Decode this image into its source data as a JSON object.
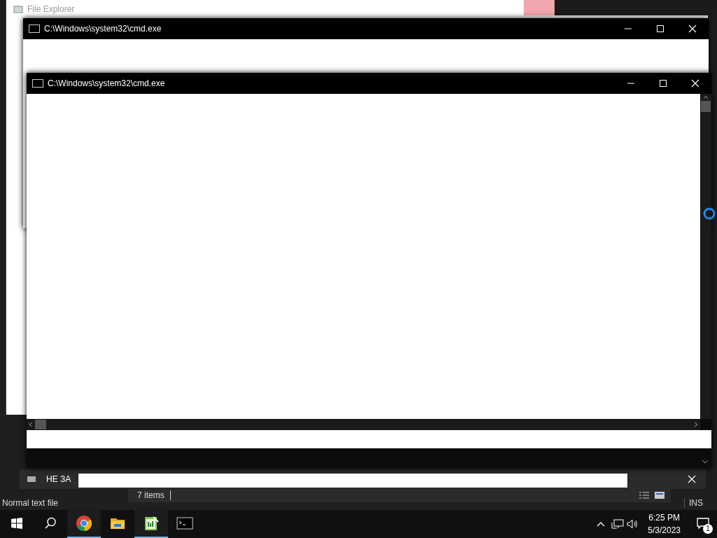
{
  "notepad": {
    "status_bar": {
      "file_type": "Normal text file",
      "mode": "INS"
    }
  },
  "explorer": {
    "title": "File Explorer",
    "status": "7 items"
  },
  "notification": {
    "text": "НЕ ЗА"
  },
  "cmd_windows": [
    {
      "title": "C:\\Windows\\system32\\cmd.exe"
    },
    {
      "title": "C:\\Windows\\system32\\cmd.exe"
    }
  ],
  "taskbar": {
    "apps": [
      {
        "kind": "browser",
        "active": true
      },
      {
        "kind": "folder",
        "active": false
      },
      {
        "kind": "notepad",
        "active": true
      },
      {
        "kind": "terminal",
        "active": false
      }
    ],
    "time": "6:25 PM",
    "date": "5/3/2023",
    "notifications": "1"
  }
}
